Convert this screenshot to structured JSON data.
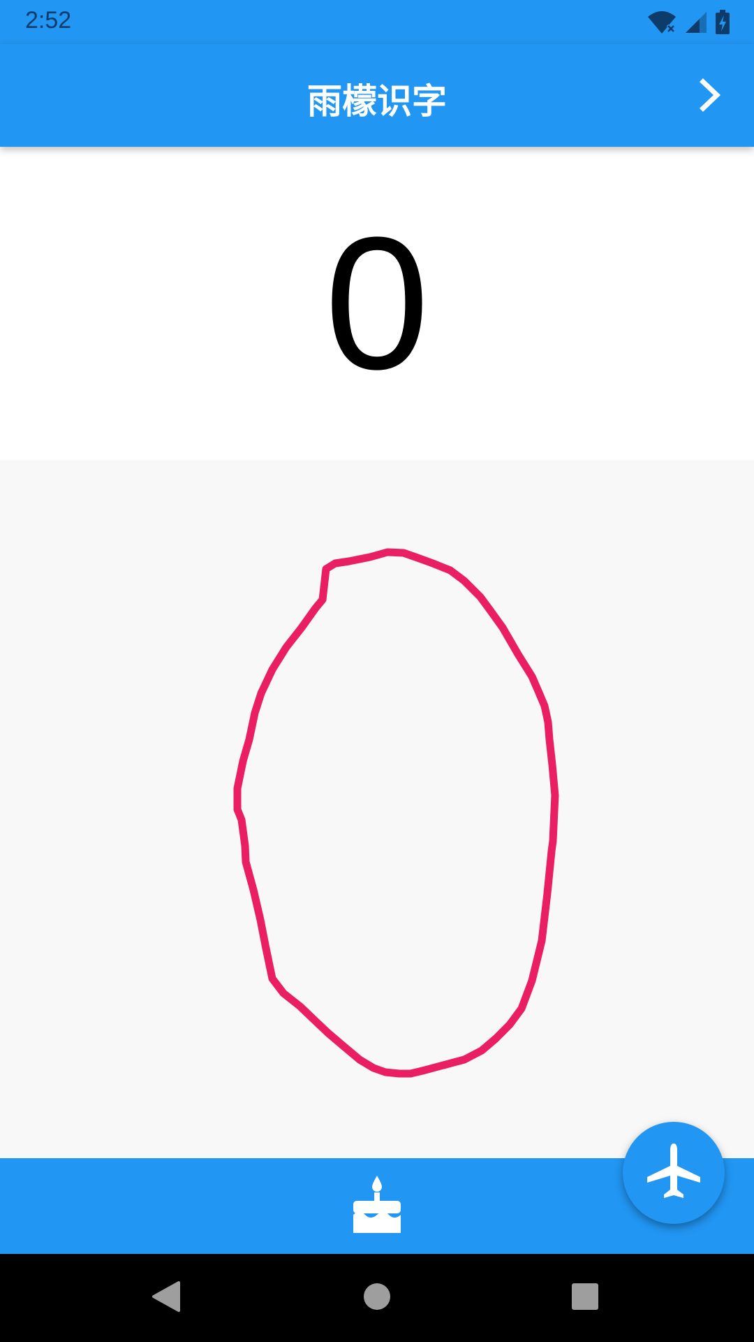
{
  "status_bar": {
    "time": "2:52",
    "icons": [
      "wifi-off-icon",
      "cell-signal-icon",
      "battery-charging-icon"
    ]
  },
  "app_bar": {
    "title": "雨檬识字",
    "action_icon": "chevron-right-icon"
  },
  "result": {
    "recognized": "0"
  },
  "canvas": {
    "stroke_color": "#e91e63",
    "background": "#f8f8f8"
  },
  "bottom_bar": {
    "icon": "cake-icon"
  },
  "fab": {
    "icon": "airplane-icon"
  },
  "nav_bar": {
    "icons": [
      "back-icon",
      "home-icon",
      "recents-icon"
    ]
  },
  "colors": {
    "primary": "#2196f3",
    "accent": "#e91e63"
  }
}
